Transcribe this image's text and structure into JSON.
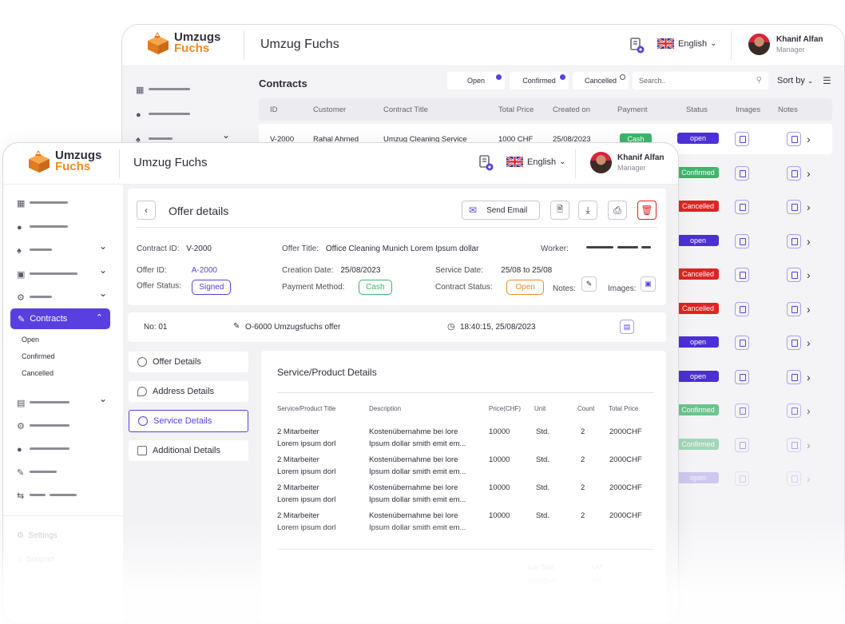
{
  "brand": {
    "word1": "Umzugs",
    "word2": "Fuchs",
    "app_title": "Umzug Fuchs"
  },
  "language": "English",
  "user": {
    "name": "Khanif Alfan",
    "role": "Manager"
  },
  "back": {
    "page_title": "Contracts",
    "filters": [
      {
        "label": "Open"
      },
      {
        "label": "Confirmed"
      },
      {
        "label": "Cancelled"
      }
    ],
    "search_placeholder": "Search..",
    "sort_label": "Sort by",
    "columns": [
      "ID",
      "Customer",
      "Contract Title",
      "Total Price",
      "Created on",
      "Payment",
      "Status",
      "Images",
      "Notes"
    ],
    "first_row": {
      "id": "V-2000",
      "customer": "Rahal Ahmed",
      "title": "Umzug Cleaning Service",
      "price": "1000 CHF",
      "date": "25/08/2023",
      "payment": "Cash",
      "status": "open"
    },
    "statuses": [
      "open",
      "Confirmed",
      "Cancelled",
      "open",
      "Cancelled",
      "Cancelled",
      "open",
      "open",
      "Confirmed",
      "Confirmed",
      "open"
    ]
  },
  "sidebar": {
    "contracts_label": "Contracts",
    "sub_items": [
      "Open",
      "Confirmed",
      "Cancelled"
    ],
    "settings": "Settings",
    "support": "Support"
  },
  "offer": {
    "title": "Offer details",
    "send_email": "Send Email",
    "contract_id_label": "Contract ID:",
    "contract_id": "V-2000",
    "offer_title_label": "Offer Title:",
    "offer_title": "Office Cleaning Munich Lorem Ipsum dollar",
    "worker_label": "Worker:",
    "offer_id_label": "Offer ID:",
    "offer_id": "A-2000",
    "creation_label": "Creation Date:",
    "creation": "25/08/2023",
    "service_date_label": "Service Date:",
    "service_date": "25/08 to 25/08",
    "offer_status_label": "Offer Status:",
    "offer_status": "Signed",
    "payment_label": "Payment Method:",
    "payment": "Cash",
    "contract_status_label": "Contract Status:",
    "contract_status": "Open",
    "notes_label": "Notes:",
    "images_label": "Images:"
  },
  "record": {
    "no": "No:  01",
    "ref": "O-6000 Umzugsfuchs offer",
    "time": "18:40:15, 25/08/2023"
  },
  "tabs": [
    "Offer  Details",
    "Address Details",
    "Service Details",
    "Additional Details"
  ],
  "service": {
    "heading": "Service/Product Details",
    "columns": [
      "Service/Product Title",
      "Description",
      "Price(CHF)",
      "Unit",
      "Count",
      "Total Price"
    ],
    "rows": [
      {
        "title1": "2 Mitarbeiter",
        "title2": "Lorem ipsum dorl",
        "desc1": "Kostenübernahme bei lore",
        "desc2": "Ipsum dollar smith emit em...",
        "price": "10000",
        "unit": "Std.",
        "count": "2",
        "total": "2000CHF"
      },
      {
        "title1": "2 Mitarbeiter",
        "title2": "Lorem ipsum dorl",
        "desc1": "Kostenübernahme bei lore",
        "desc2": "Ipsum dollar smith emit em...",
        "price": "10000",
        "unit": "Std.",
        "count": "2",
        "total": "2000CHF"
      },
      {
        "title1": "2 Mitarbeiter",
        "title2": "Lorem ipsum dorl",
        "desc1": "Kostenübernahme bei lore",
        "desc2": "Ipsum dollar smith emit em...",
        "price": "10000",
        "unit": "Std.",
        "count": "2",
        "total": "2000CHF"
      },
      {
        "title1": "2 Mitarbeiter",
        "title2": "Lorem ipsum dorl",
        "desc1": "Kostenübernahme bei lore",
        "desc2": "Ipsum dollar smith emit em...",
        "price": "10000",
        "unit": "Std.",
        "count": "2",
        "total": "2000CHF"
      }
    ],
    "subtotal_label": "Sub Total",
    "subtotal": "2000CHF",
    "vat_label": "VAT",
    "vat": "0%"
  },
  "colors": {
    "accent": "#5a3fe0",
    "orange": "#f08a24",
    "green": "#3fb46a",
    "red": "#e32121"
  }
}
